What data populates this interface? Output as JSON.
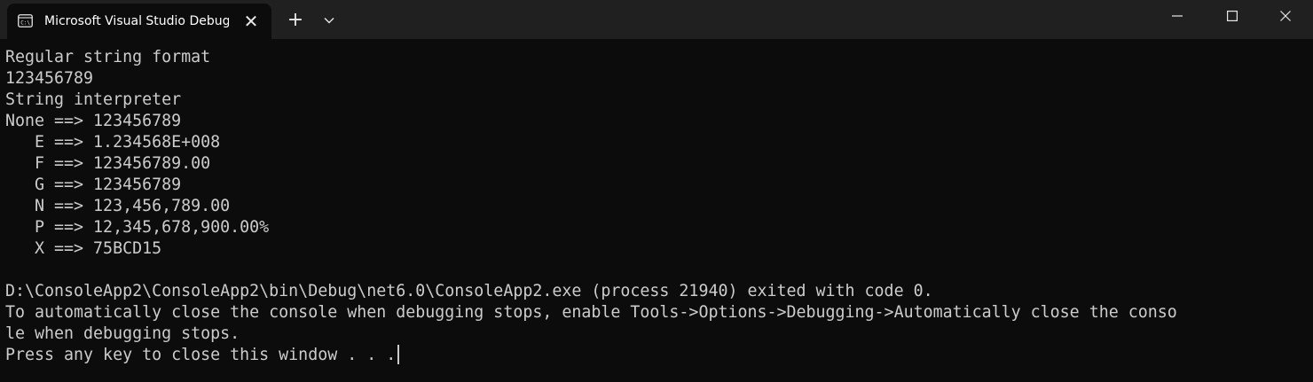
{
  "window": {
    "tab_title": "Microsoft Visual Studio Debug Console",
    "tab_icon": "console-icon",
    "tab_close": "✕",
    "new_tab": "+",
    "dropdown_icon": "chevron-down-icon",
    "controls": [
      "minimize-icon",
      "maximize-icon",
      "close-icon"
    ]
  },
  "console": {
    "lines": [
      "Regular string format",
      "123456789",
      "String interpreter",
      "None ==> 123456789",
      "   E ==> 1.234568E+008",
      "   F ==> 123456789.00",
      "   G ==> 123456789",
      "   N ==> 123,456,789.00",
      "   P ==> 12,345,678,900.00%",
      "   X ==> 75BCD15",
      "",
      "D:\\ConsoleApp2\\ConsoleApp2\\bin\\Debug\\net6.0\\ConsoleApp2.exe (process 21940) exited with code 0.",
      "To automatically close the console when debugging stops, enable Tools->Options->Debugging->Automatically close the conso",
      "le when debugging stops.",
      "Press any key to close this window . . ."
    ]
  },
  "colors": {
    "titlebar_bg": "#202020",
    "console_bg": "#0c0c0c",
    "console_fg": "#cccccc"
  }
}
